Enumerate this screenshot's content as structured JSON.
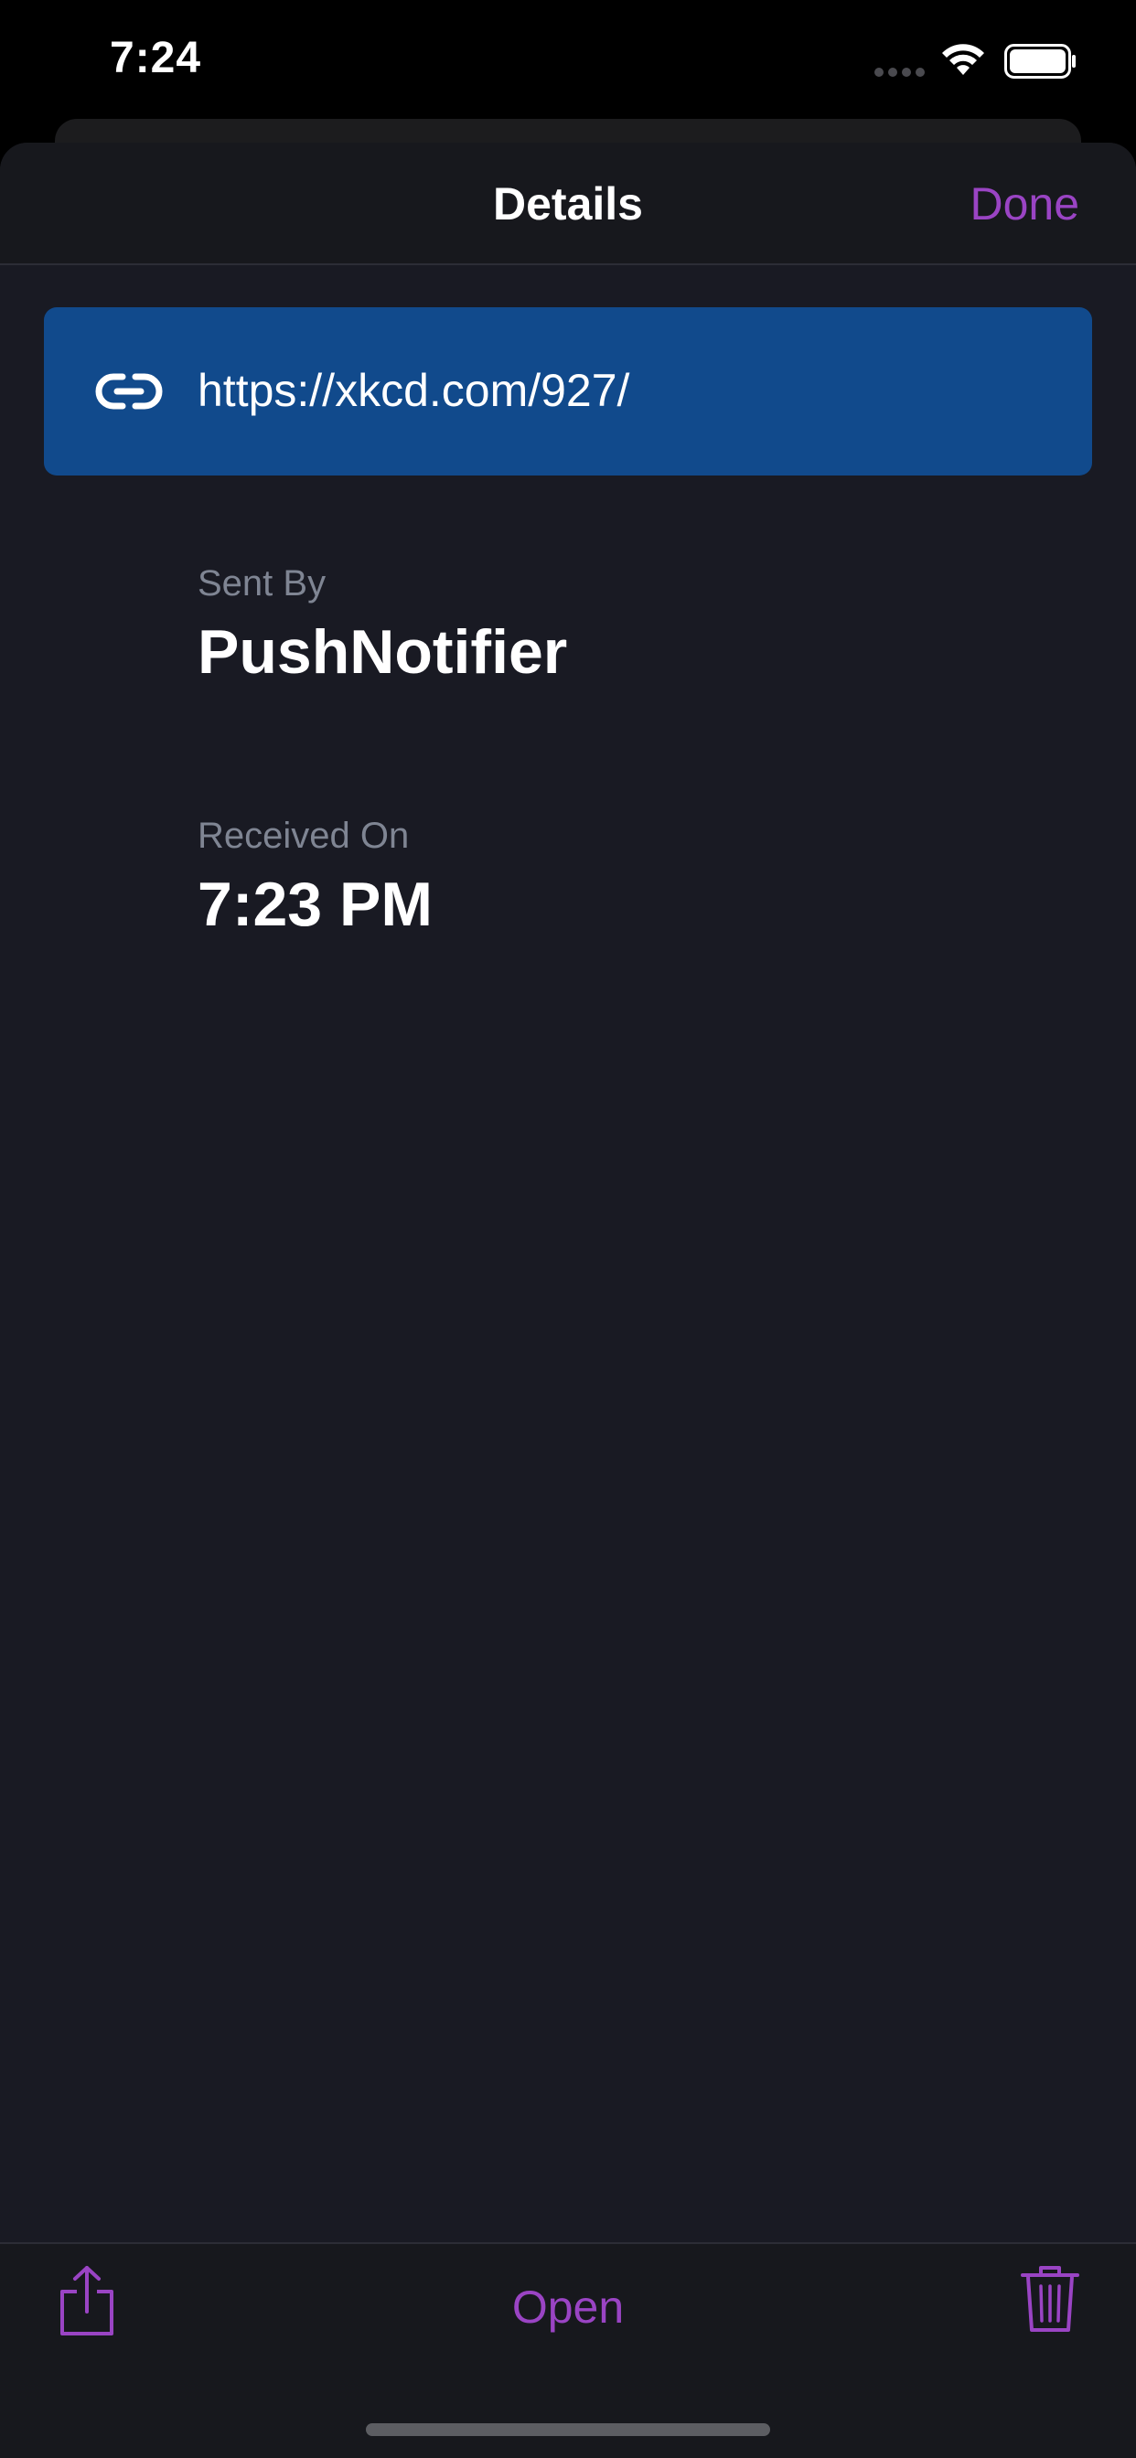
{
  "status_bar": {
    "time": "7:24"
  },
  "nav": {
    "title": "Details",
    "done_label": "Done"
  },
  "url_card": {
    "url": "https://xkcd.com/927/",
    "icon": "link-icon"
  },
  "sent_by": {
    "label": "Sent By",
    "value": "PushNotifier"
  },
  "received_on": {
    "label": "Received On",
    "value": "7:23 PM"
  },
  "toolbar": {
    "share_icon": "share-icon",
    "open_label": "Open",
    "delete_icon": "trash-icon"
  },
  "colors": {
    "accent": "#9a44c4",
    "url_card": "#114a8c",
    "sheet_bg": "#191a23",
    "label_gray": "#7f8593"
  }
}
